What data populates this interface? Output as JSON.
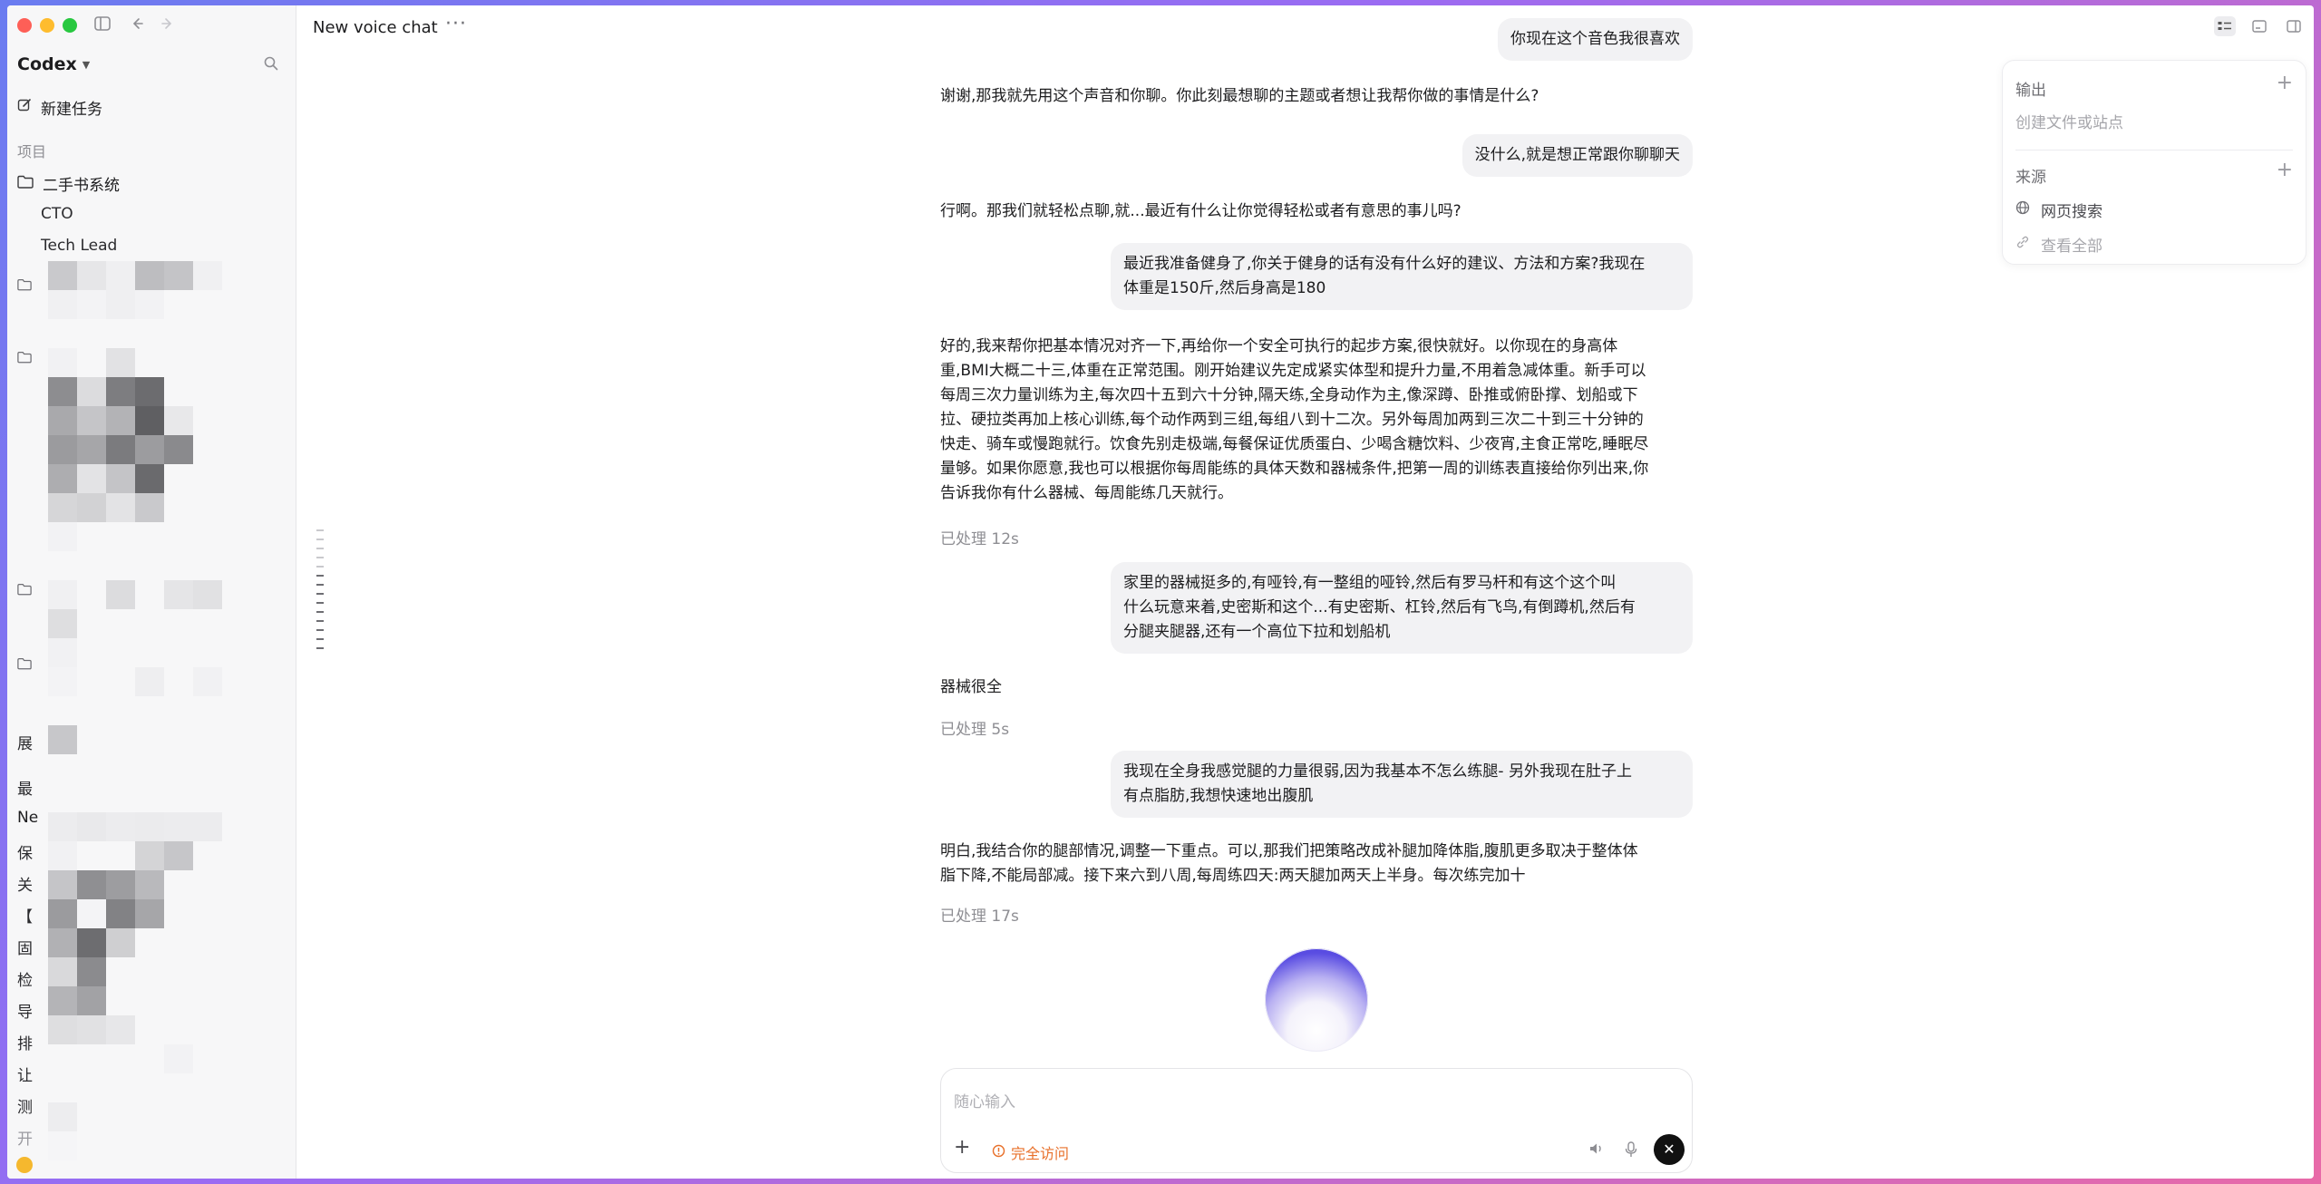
{
  "app": {
    "workspace": "Codex"
  },
  "sidebar": {
    "new_task": "新建任务",
    "projects_label": "项目",
    "project_name": "二手书系统",
    "subitems": [
      "CTO",
      "Tech Lead"
    ],
    "partial_labels": [
      "展",
      "最",
      "Ne",
      "保",
      "关",
      "【",
      "固",
      "检",
      "导",
      "排",
      "让",
      "测",
      "开"
    ]
  },
  "header": {
    "title": "New voice chat",
    "more": "···"
  },
  "messages": {
    "u1": "你现在这个音色我很喜欢",
    "a1": "谢谢,那我就先用这个声音和你聊。你此刻最想聊的主题或者想让我帮你做的事情是什么?",
    "u2": "没什么,就是想正常跟你聊聊天",
    "a2": "行啊。那我们就轻松点聊,就...最近有什么让你觉得轻松或者有意思的事儿吗?",
    "u3_l1": "最近我准备健身了,你关于健身的话有没有什么好的建议、方法和方案?我现在",
    "u3_l2": "体重是150斤,然后身高是180",
    "a3_lines": [
      "好的,我来帮你把基本情况对齐一下,再给你一个安全可执行的起步方案,很快就好。以你现在的身高体",
      "重,BMI大概二十三,体重在正常范围。刚开始建议先定成紧实体型和提升力量,不用着急减体重。新手可以",
      "每周三次力量训练为主,每次四十五到六十分钟,隔天练,全身动作为主,像深蹲、卧推或俯卧撑、划船或下",
      "拉、硬拉类再加上核心训练,每个动作两到三组,每组八到十二次。另外每周加两到三次二十到三十分钟的",
      "快走、骑车或慢跑就行。饮食先别走极端,每餐保证优质蛋白、少喝含糖饮料、少夜宵,主食正常吃,睡眠尽",
      "量够。如果你愿意,我也可以根据你每周能练的具体天数和器械条件,把第一周的训练表直接给你列出来,你",
      "告诉我你有什么器械、每周能练几天就行。"
    ],
    "p3": "已处理 12s",
    "u4_lines": [
      "家里的器械挺多的,有哑铃,有一整组的哑铃,然后有罗马杆和有这个这个叫",
      "什么玩意来着,史密斯和这个...有史密斯、杠铃,然后有飞鸟,有倒蹲机,然后有",
      "分腿夹腿器,还有一个高位下拉和划船机"
    ],
    "a4": "器械很全",
    "p4": "已处理 5s",
    "u5_lines": [
      "我现在全身我感觉腿的力量很弱,因为我基本不怎么练腿- 另外我现在肚子上",
      "有点脂肪,我想快速地出腹肌"
    ],
    "a5_lines": [
      "明白,我结合你的腿部情况,调整一下重点。可以,那我们把策略改成补腿加降体脂,腹肌更多取决于整体体",
      "脂下降,不能局部减。接下来六到八周,每周练四天:两天腿加两天上半身。每次练完加十"
    ],
    "p5": "已处理 17s"
  },
  "composer": {
    "placeholder": "随心输入",
    "plus": "+",
    "access_label": "完全访问",
    "close": "✕"
  },
  "panel": {
    "output_label": "输出",
    "output_hint": "创建文件或站点",
    "sources_label": "来源",
    "plus": "+",
    "web_search": "网页搜索",
    "view_all": "查看全部"
  },
  "colors": {
    "accent_orange": "#e8702a",
    "orb_blue": "#4a3fdc",
    "bubble_bg": "#f2f2f4"
  }
}
